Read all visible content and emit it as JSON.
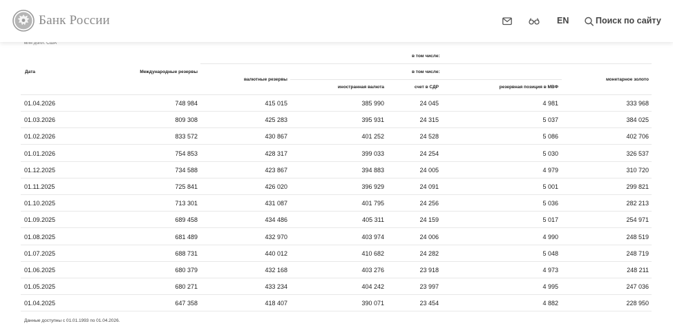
{
  "header": {
    "brand": "Банк России",
    "lang": "EN",
    "search_label": "Поиск по сайту",
    "icons": [
      "bank-emblem-icon",
      "mail-icon",
      "glasses-icon",
      "search-icon"
    ]
  },
  "table": {
    "units": "млн долл. США",
    "group_label_top": "в том числе:",
    "group_label_sub": "в том числе:",
    "columns": {
      "date": "Дата",
      "intl_reserves": "Международные резервы",
      "fx_reserves": "валютные резервы",
      "foreign_currency": "иностранная валюта",
      "sdr": "счет в СДР",
      "imf_position": "резервная позиция в МВФ",
      "gold": "монетарное золото"
    },
    "rows": [
      [
        "01.04.2026",
        "748 984",
        "415 015",
        "385 990",
        "24 045",
        "4 981",
        "333 968"
      ],
      [
        "01.03.2026",
        "809 308",
        "425 283",
        "395 931",
        "24 315",
        "5 037",
        "384 025"
      ],
      [
        "01.02.2026",
        "833 572",
        "430 867",
        "401 252",
        "24 528",
        "5 086",
        "402 706"
      ],
      [
        "01.01.2026",
        "754 853",
        "428 317",
        "399 033",
        "24 254",
        "5 030",
        "326 537"
      ],
      [
        "01.12.2025",
        "734 588",
        "423 867",
        "394 883",
        "24 005",
        "4 979",
        "310 720"
      ],
      [
        "01.11.2025",
        "725 841",
        "426 020",
        "396 929",
        "24 091",
        "5 001",
        "299 821"
      ],
      [
        "01.10.2025",
        "713 301",
        "431 087",
        "401 795",
        "24 256",
        "5 036",
        "282 213"
      ],
      [
        "01.09.2025",
        "689 458",
        "434 486",
        "405 311",
        "24 159",
        "5 017",
        "254 971"
      ],
      [
        "01.08.2025",
        "681 489",
        "432 970",
        "403 974",
        "24 006",
        "4 990",
        "248 519"
      ],
      [
        "01.07.2025",
        "688 731",
        "440 012",
        "410 682",
        "24 282",
        "5 048",
        "248 719"
      ],
      [
        "01.06.2025",
        "680 379",
        "432 168",
        "403 276",
        "23 918",
        "4 973",
        "248 211"
      ],
      [
        "01.05.2025",
        "680 271",
        "433 234",
        "404 242",
        "23 997",
        "4 995",
        "247 036"
      ],
      [
        "01.04.2025",
        "647 358",
        "418 407",
        "390 071",
        "23 454",
        "4 882",
        "228 950"
      ]
    ],
    "footnote": "Данные доступны с 01.01.1993 по 01.04.2026."
  }
}
